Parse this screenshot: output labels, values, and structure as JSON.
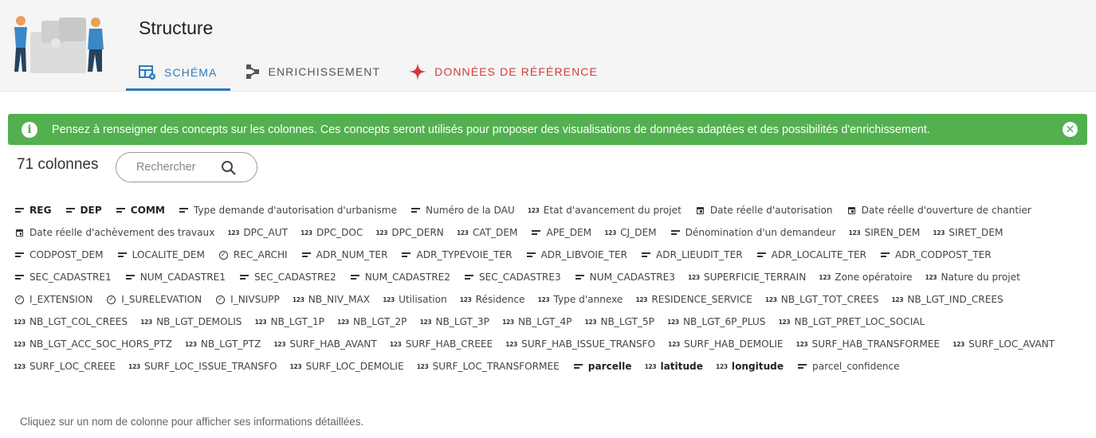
{
  "header": {
    "title": "Structure",
    "tabs": [
      {
        "label": "SCHÉMA",
        "active": true,
        "icon": "table-settings-icon",
        "color": "#2b7bbf"
      },
      {
        "label": "ENRICHISSEMENT",
        "active": false,
        "icon": "graph-nodes-icon",
        "color": "#555555"
      },
      {
        "label": "DONNÉES DE RÉFÉRENCE",
        "active": false,
        "icon": "sparkle-star-icon",
        "color": "#d33a3a"
      }
    ]
  },
  "alert": {
    "text": "Pensez à renseigner des concepts sur les colonnes. Ces concepts seront utilisés pour proposer des visualisations de données adaptées et des possibilités d'enrichissement.",
    "icon": "info-icon",
    "close_icon": "close-icon",
    "color": "#52b04f"
  },
  "toolbar": {
    "column_count": "71 colonnes",
    "search_placeholder": "Rechercher",
    "search_value": ""
  },
  "columns": [
    {
      "name": "REG",
      "type": "string",
      "bold": true
    },
    {
      "name": "DEP",
      "type": "string",
      "bold": true
    },
    {
      "name": "COMM",
      "type": "string",
      "bold": true
    },
    {
      "name": "Type demande d'autorisation d'urbanisme",
      "type": "string"
    },
    {
      "name": "Numéro de la DAU",
      "type": "string"
    },
    {
      "name": "Etat d'avancement du projet",
      "type": "number"
    },
    {
      "name": "Date réelle d'autorisation",
      "type": "date"
    },
    {
      "name": "Date réelle d'ouverture de chantier",
      "type": "date"
    },
    {
      "name": "Date réelle d'achèvement des travaux",
      "type": "date"
    },
    {
      "name": "DPC_AUT",
      "type": "number"
    },
    {
      "name": "DPC_DOC",
      "type": "number"
    },
    {
      "name": "DPC_DERN",
      "type": "number"
    },
    {
      "name": "CAT_DEM",
      "type": "number"
    },
    {
      "name": "APE_DEM",
      "type": "string"
    },
    {
      "name": "CJ_DEM",
      "type": "number"
    },
    {
      "name": "Dénomination d'un demandeur",
      "type": "string"
    },
    {
      "name": "SIREN_DEM",
      "type": "number"
    },
    {
      "name": "SIRET_DEM",
      "type": "number"
    },
    {
      "name": "CODPOST_DEM",
      "type": "string"
    },
    {
      "name": "LOCALITE_DEM",
      "type": "string"
    },
    {
      "name": "REC_ARCHI",
      "type": "boolean"
    },
    {
      "name": "ADR_NUM_TER",
      "type": "string"
    },
    {
      "name": "ADR_TYPEVOIE_TER",
      "type": "string"
    },
    {
      "name": "ADR_LIBVOIE_TER",
      "type": "string"
    },
    {
      "name": "ADR_LIEUDIT_TER",
      "type": "string"
    },
    {
      "name": "ADR_LOCALITE_TER",
      "type": "string"
    },
    {
      "name": "ADR_CODPOST_TER",
      "type": "string"
    },
    {
      "name": "SEC_CADASTRE1",
      "type": "string"
    },
    {
      "name": "NUM_CADASTRE1",
      "type": "string"
    },
    {
      "name": "SEC_CADASTRE2",
      "type": "string"
    },
    {
      "name": "NUM_CADASTRE2",
      "type": "string"
    },
    {
      "name": "SEC_CADASTRE3",
      "type": "string"
    },
    {
      "name": "NUM_CADASTRE3",
      "type": "string"
    },
    {
      "name": "SUPERFICIE_TERRAIN",
      "type": "number"
    },
    {
      "name": "Zone opératoire",
      "type": "number"
    },
    {
      "name": "Nature du projet",
      "type": "number"
    },
    {
      "name": "I_EXTENSION",
      "type": "boolean"
    },
    {
      "name": "I_SURELEVATION",
      "type": "boolean"
    },
    {
      "name": "I_NIVSUPP",
      "type": "boolean"
    },
    {
      "name": "NB_NIV_MAX",
      "type": "number"
    },
    {
      "name": "Utilisation",
      "type": "number"
    },
    {
      "name": "Résidence",
      "type": "number"
    },
    {
      "name": "Type d'annexe",
      "type": "number"
    },
    {
      "name": "RESIDENCE_SERVICE",
      "type": "number"
    },
    {
      "name": "NB_LGT_TOT_CREES",
      "type": "number"
    },
    {
      "name": "NB_LGT_IND_CREES",
      "type": "number"
    },
    {
      "name": "NB_LGT_COL_CREES",
      "type": "number"
    },
    {
      "name": "NB_LGT_DEMOLIS",
      "type": "number"
    },
    {
      "name": "NB_LGT_1P",
      "type": "number"
    },
    {
      "name": "NB_LGT_2P",
      "type": "number"
    },
    {
      "name": "NB_LGT_3P",
      "type": "number"
    },
    {
      "name": "NB_LGT_4P",
      "type": "number"
    },
    {
      "name": "NB_LGT_5P",
      "type": "number"
    },
    {
      "name": "NB_LGT_6P_PLUS",
      "type": "number"
    },
    {
      "name": "NB_LGT_PRET_LOC_SOCIAL",
      "type": "number"
    },
    {
      "name": "NB_LGT_ACC_SOC_HORS_PTZ",
      "type": "number"
    },
    {
      "name": "NB_LGT_PTZ",
      "type": "number"
    },
    {
      "name": "SURF_HAB_AVANT",
      "type": "number"
    },
    {
      "name": "SURF_HAB_CREEE",
      "type": "number"
    },
    {
      "name": "SURF_HAB_ISSUE_TRANSFO",
      "type": "number"
    },
    {
      "name": "SURF_HAB_DEMOLIE",
      "type": "number"
    },
    {
      "name": "SURF_HAB_TRANSFORMEE",
      "type": "number"
    },
    {
      "name": "SURF_LOC_AVANT",
      "type": "number"
    },
    {
      "name": "SURF_LOC_CREEE",
      "type": "number"
    },
    {
      "name": "SURF_LOC_ISSUE_TRANSFO",
      "type": "number"
    },
    {
      "name": "SURF_LOC_DEMOLIE",
      "type": "number"
    },
    {
      "name": "SURF_LOC_TRANSFORMEE",
      "type": "number"
    },
    {
      "name": "parcelle",
      "type": "string",
      "bold": true
    },
    {
      "name": "latitude",
      "type": "number",
      "bold": true
    },
    {
      "name": "longitude",
      "type": "number",
      "bold": true
    },
    {
      "name": "parcel_confidence",
      "type": "string"
    }
  ],
  "type_icons": {
    "string": "text-lines-icon",
    "number": "number-123-icon",
    "date": "calendar-icon",
    "boolean": "check-circle-icon"
  },
  "number_icon_text": "123",
  "hint": "Cliquez sur un nom de colonne pour afficher ses informations détaillées."
}
